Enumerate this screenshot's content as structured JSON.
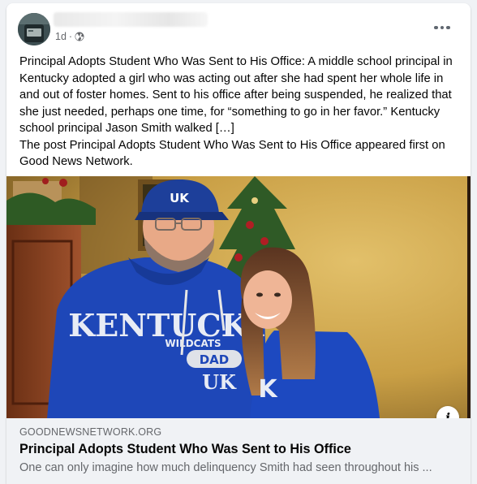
{
  "post": {
    "time": "1d",
    "separator": "·",
    "body": "Principal Adopts Student Who Was Sent to His Office: A middle school principal in Kentucky adopted a girl who was acting out after she had spent her whole life in and out of foster homes. Sent to his office after being suspended, he realized that she just needed, perhaps one time, for “something to go in her favor.” Kentucky school principal Jason Smith walked […]\nThe post Principal Adopts Student Who Was Sent to His Office appeared first on Good News Network."
  },
  "photo": {
    "hoodie_left_text": "KENTUCKY",
    "hoodie_left_sub": "WILDCATS",
    "hoodie_left_badge": "DAD",
    "hoodie_left_logo": "UK"
  },
  "link": {
    "domain": "GOODNEWSNETWORK.ORG",
    "title": "Principal Adopts Student Who Was Sent to His Office",
    "description": "One can only imagine how much delinquency Smith had seen throughout his ..."
  },
  "icons": {
    "info": "i",
    "privacy": "globe-icon",
    "menu": "more-options-icon"
  },
  "colors": {
    "background": "#f0f2f5",
    "secondary_text": "#65676b",
    "hoodie_blue": "#1e47b8"
  }
}
